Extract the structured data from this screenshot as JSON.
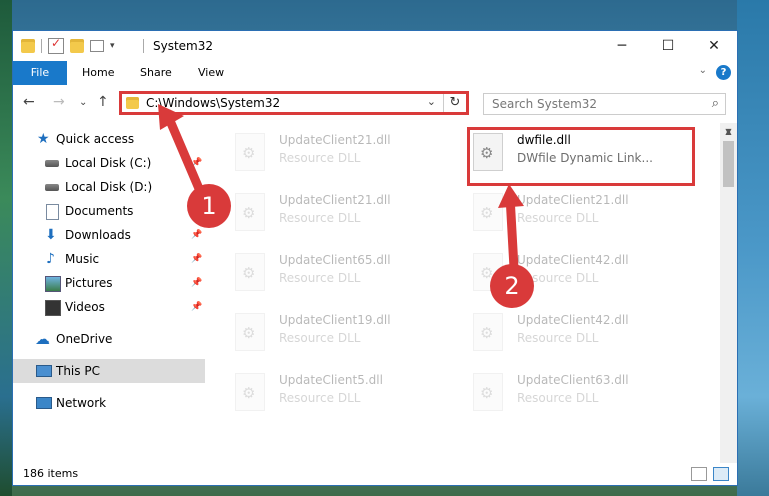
{
  "window": {
    "title": "System32",
    "controls": {
      "minimize": "─",
      "maximize": "☐",
      "close": "✕"
    }
  },
  "ribbon": {
    "tabs": [
      "File",
      "Home",
      "Share",
      "View"
    ],
    "expand": "⌄",
    "help": "?"
  },
  "nav": {
    "back": "←",
    "forward": "→",
    "recent": "⌄",
    "up": "↑",
    "address": "C:\\Windows\\System32",
    "address_dropdown": "⌄",
    "refresh": "↻",
    "search_placeholder": "Search System32"
  },
  "sidebar": {
    "items": [
      {
        "label": "Quick access",
        "icon": "star-icon",
        "pinned": false
      },
      {
        "label": "Local Disk (C:)",
        "icon": "disk-icon",
        "pinned": true
      },
      {
        "label": "Local Disk (D:)",
        "icon": "disk-icon",
        "pinned": false
      },
      {
        "label": "Documents",
        "icon": "document-icon",
        "pinned": true
      },
      {
        "label": "Downloads",
        "icon": "download-icon",
        "pinned": true
      },
      {
        "label": "Music",
        "icon": "music-icon",
        "pinned": true
      },
      {
        "label": "Pictures",
        "icon": "pictures-icon",
        "pinned": true
      },
      {
        "label": "Videos",
        "icon": "videos-icon",
        "pinned": true
      },
      {
        "label": "OneDrive",
        "icon": "cloud-icon",
        "pinned": false
      },
      {
        "label": "This PC",
        "icon": "computer-icon",
        "pinned": false
      },
      {
        "label": "Network",
        "icon": "network-icon",
        "pinned": false
      }
    ],
    "selected": "This PC"
  },
  "files": [
    {
      "name": "UpdateClient21.dll",
      "type": "Resource DLL",
      "faded": true
    },
    {
      "name": "dwfile.dll",
      "type": "DWfile Dynamic Link...",
      "faded": false
    },
    {
      "name": "UpdateClient21.dll",
      "type": "Resource DLL",
      "faded": true
    },
    {
      "name": "UpdateClient21.dll",
      "type": "Resource DLL",
      "faded": true
    },
    {
      "name": "UpdateClient65.dll",
      "type": "Resource DLL",
      "faded": true
    },
    {
      "name": "UpdateClient42.dll",
      "type": "Resource DLL",
      "faded": true
    },
    {
      "name": "UpdateClient19.dll",
      "type": "Resource DLL",
      "faded": true
    },
    {
      "name": "UpdateClient42.dll",
      "type": "Resource DLL",
      "faded": true
    },
    {
      "name": "UpdateClient5.dll",
      "type": "Resource DLL",
      "faded": true
    },
    {
      "name": "UpdateClient63.dll",
      "type": "Resource DLL",
      "faded": true
    }
  ],
  "status": {
    "item_count": "186 items"
  },
  "annotations": {
    "step1": "1",
    "step2": "2",
    "color": "#d93a3a"
  }
}
